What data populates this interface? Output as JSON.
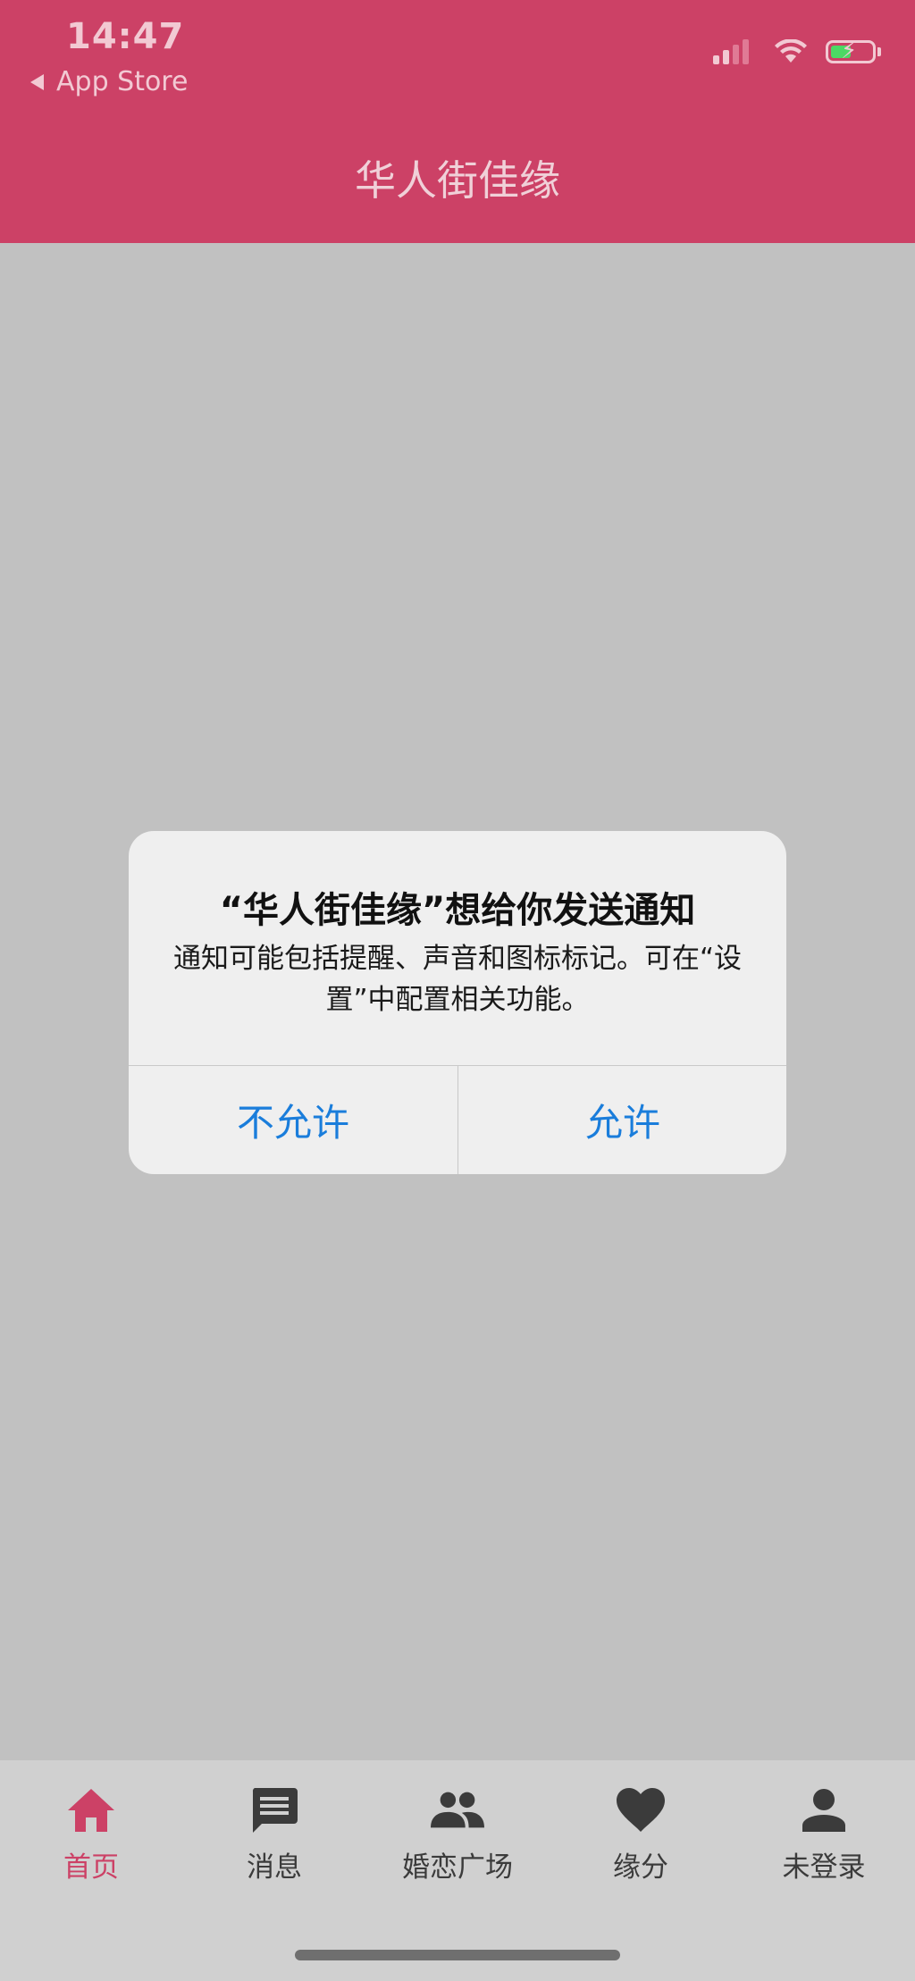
{
  "status_bar": {
    "time": "14:47",
    "back_label": "App Store"
  },
  "header": {
    "title": "华人街佳缘"
  },
  "alert": {
    "title": "“华人街佳缘”想给你发送通知",
    "message": "通知可能包括提醒、声音和图标标记。可在“设置”中配置相关功能。",
    "deny_label": "不允许",
    "allow_label": "允许"
  },
  "tabs": [
    {
      "label": "首页",
      "icon": "home-icon",
      "active": true
    },
    {
      "label": "消息",
      "icon": "message-icon",
      "active": false
    },
    {
      "label": "婚恋广场",
      "icon": "people-icon",
      "active": false
    },
    {
      "label": "缘分",
      "icon": "heart-icon",
      "active": false
    },
    {
      "label": "未登录",
      "icon": "person-icon",
      "active": false
    }
  ],
  "colors": {
    "brand": "#cc4166",
    "alert_button": "#1a7ddb",
    "tab_inactive": "#3b3b3b",
    "background_overlay": "#c1c1c1"
  }
}
